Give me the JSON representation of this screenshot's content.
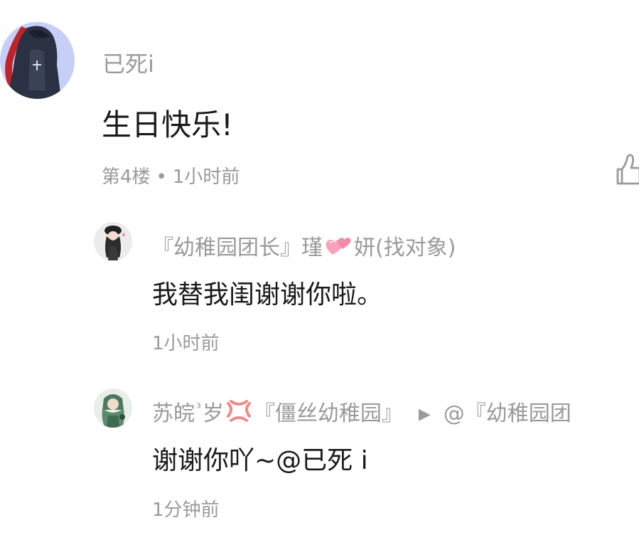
{
  "comment": {
    "username": "已死i",
    "content": "生日快乐!",
    "floor": "第4楼",
    "separator": "•",
    "time": "1小时前",
    "like_icon": "thumbs-up-icon"
  },
  "replies": [
    {
      "username_prefix": "『幼稚园团长』瑾",
      "username_emoji": "two-hearts-icon",
      "username_suffix": "妍(找对象)",
      "content": "我替我闺谢谢你啦。",
      "time": "1小时前"
    },
    {
      "username_prefix": "苏皖",
      "age_sup": "³",
      "username_mid": "岁",
      "username_emoji": "anger-symbol-icon",
      "username_suffix": "『僵丝幼稚园』",
      "reply_arrow": "▶",
      "reply_target": "@『幼稚园团",
      "content": "谢谢你吖~@已死 i",
      "time": "1分钟前"
    }
  ],
  "colors": {
    "text_primary": "#1a1a1a",
    "text_secondary": "#9a9a9a",
    "avatar_main_bg": "#c7cff6",
    "heart_pink": "#f28aa8",
    "anger_red": "#f08a8a"
  }
}
